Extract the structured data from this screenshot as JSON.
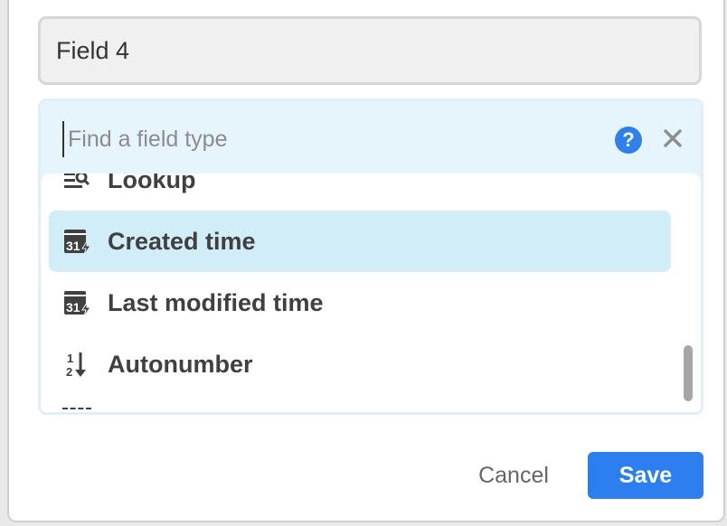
{
  "field_name": "Field 4",
  "search": {
    "placeholder": "Find a field type",
    "value": ""
  },
  "field_types": [
    {
      "label": "Lookup",
      "icon": "lookup-icon",
      "selected": false
    },
    {
      "label": "Created time",
      "icon": "created-time-icon",
      "selected": true
    },
    {
      "label": "Last modified time",
      "icon": "last-modified-time-icon",
      "selected": false
    },
    {
      "label": "Autonumber",
      "icon": "autonumber-icon",
      "selected": false
    }
  ],
  "actions": {
    "cancel_label": "Cancel",
    "save_label": "Save"
  },
  "colors": {
    "accent": "#2d7ff0",
    "selected_row": "#d0edf8",
    "picker_header": "#e6f5fb"
  }
}
